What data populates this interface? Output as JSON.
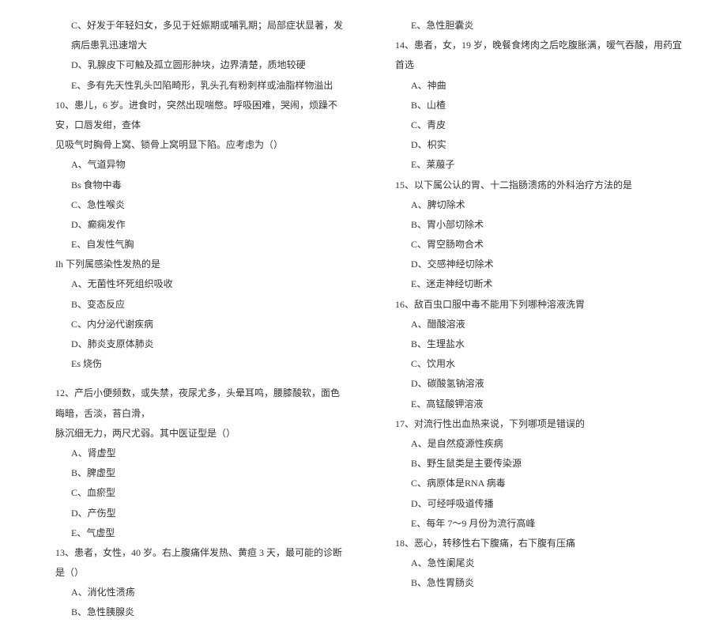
{
  "left_column": {
    "q9_options": {
      "c": "C、好发于年轻妇女，多见于妊娠期或哺乳期；局部症状显著，发病后患乳迅速增大",
      "d": "D、乳腺皮下可触及孤立圆形肿块，边界清楚，质地较硬",
      "e": "E、多有先天性乳头凹陷畸形，乳头孔有粉刺样或油脂样物溢出"
    },
    "q10": {
      "stem1": "10、患儿，6 岁。进食时，突然出现喘憋。呼吸困难，哭闹，烦躁不安，口唇发绀，查体",
      "stem2": "见吸气时胸骨上窝、锁骨上窝明显下陷。应考虑为（）",
      "a": "A、气道异物",
      "b": "Bs 食物中毒",
      "c": "C、急性喉炎",
      "d": "D、癫痫发作",
      "e": "E、自发性气胸"
    },
    "q11": {
      "stem": "Ih 下列属感染性发热的是",
      "a": "A、无菌性坏死组织吸收",
      "b": "B、变态反应",
      "c": "C、内分泌代谢疾病",
      "d": "D、肺炎支原体肺炎",
      "e": "Es 烧伤"
    },
    "q12": {
      "stem1": "12、产后小便频数，或失禁，夜尿尤多，头晕耳鸣，腰膝酸软，面色晦暗，舌淡，苔白滑，",
      "stem2": "脉沉细无力，两尺尤弱。其中医证型是（）",
      "a": "A、肾虚型",
      "b": "B、脾虚型",
      "c": "C、血瘀型",
      "d": "D、产伤型",
      "e": "E、气虚型"
    },
    "q13": {
      "stem": "13、患者，女性，40 岁。右上腹痛伴发热、黄疸 3 天，最可能的诊断是（）",
      "a": "A、消化性溃疡",
      "b": "B、急性胰腺炎"
    }
  },
  "right_column": {
    "q13_e": "E、急性胆囊炎",
    "q14": {
      "stem": "14、患者，女，19 岁，晚餐食烤肉之后吃腹胀满，嗳气吞酸，用药宜首选",
      "a": "A、神曲",
      "b": "B、山楂",
      "c": "C、青皮",
      "d": "D、枳实",
      "e": "E、莱菔子"
    },
    "q15": {
      "stem": "15、以下属公认的胃、十二指肠溃疡的外科治疗方法的是",
      "a": "A、脾切除术",
      "b": "B、胃小部切除术",
      "c": "C、胃空肠吻合术",
      "d": "D、交感神经切除术",
      "e": "E、迷走神经切断术"
    },
    "q16": {
      "stem": "16、敌百虫口服中毒不能用下列哪种溶液洗胃",
      "a": "A、醋酸溶液",
      "b": "B、生理盐水",
      "c": "C、饮用水",
      "d": "D、碳酸氢钠溶液",
      "e": "E、高锰酸钾溶液"
    },
    "q17": {
      "stem": "17、对流行性出血热来说，下列哪项是错误的",
      "a": "A、是自然疫源性疾病",
      "b": "B、野生鼠类是主要传染源",
      "c": "C、病原体是RNA 病毒",
      "d": "D、可经呼吸道传播",
      "e": "E、每年 7～9 月份为流行高峰"
    },
    "q18": {
      "stem": "18、恶心，转移性右下腹痛，右下腹有压痛",
      "a": "A、急性阑尾炎",
      "b": "B、急性胃肠炎"
    }
  }
}
